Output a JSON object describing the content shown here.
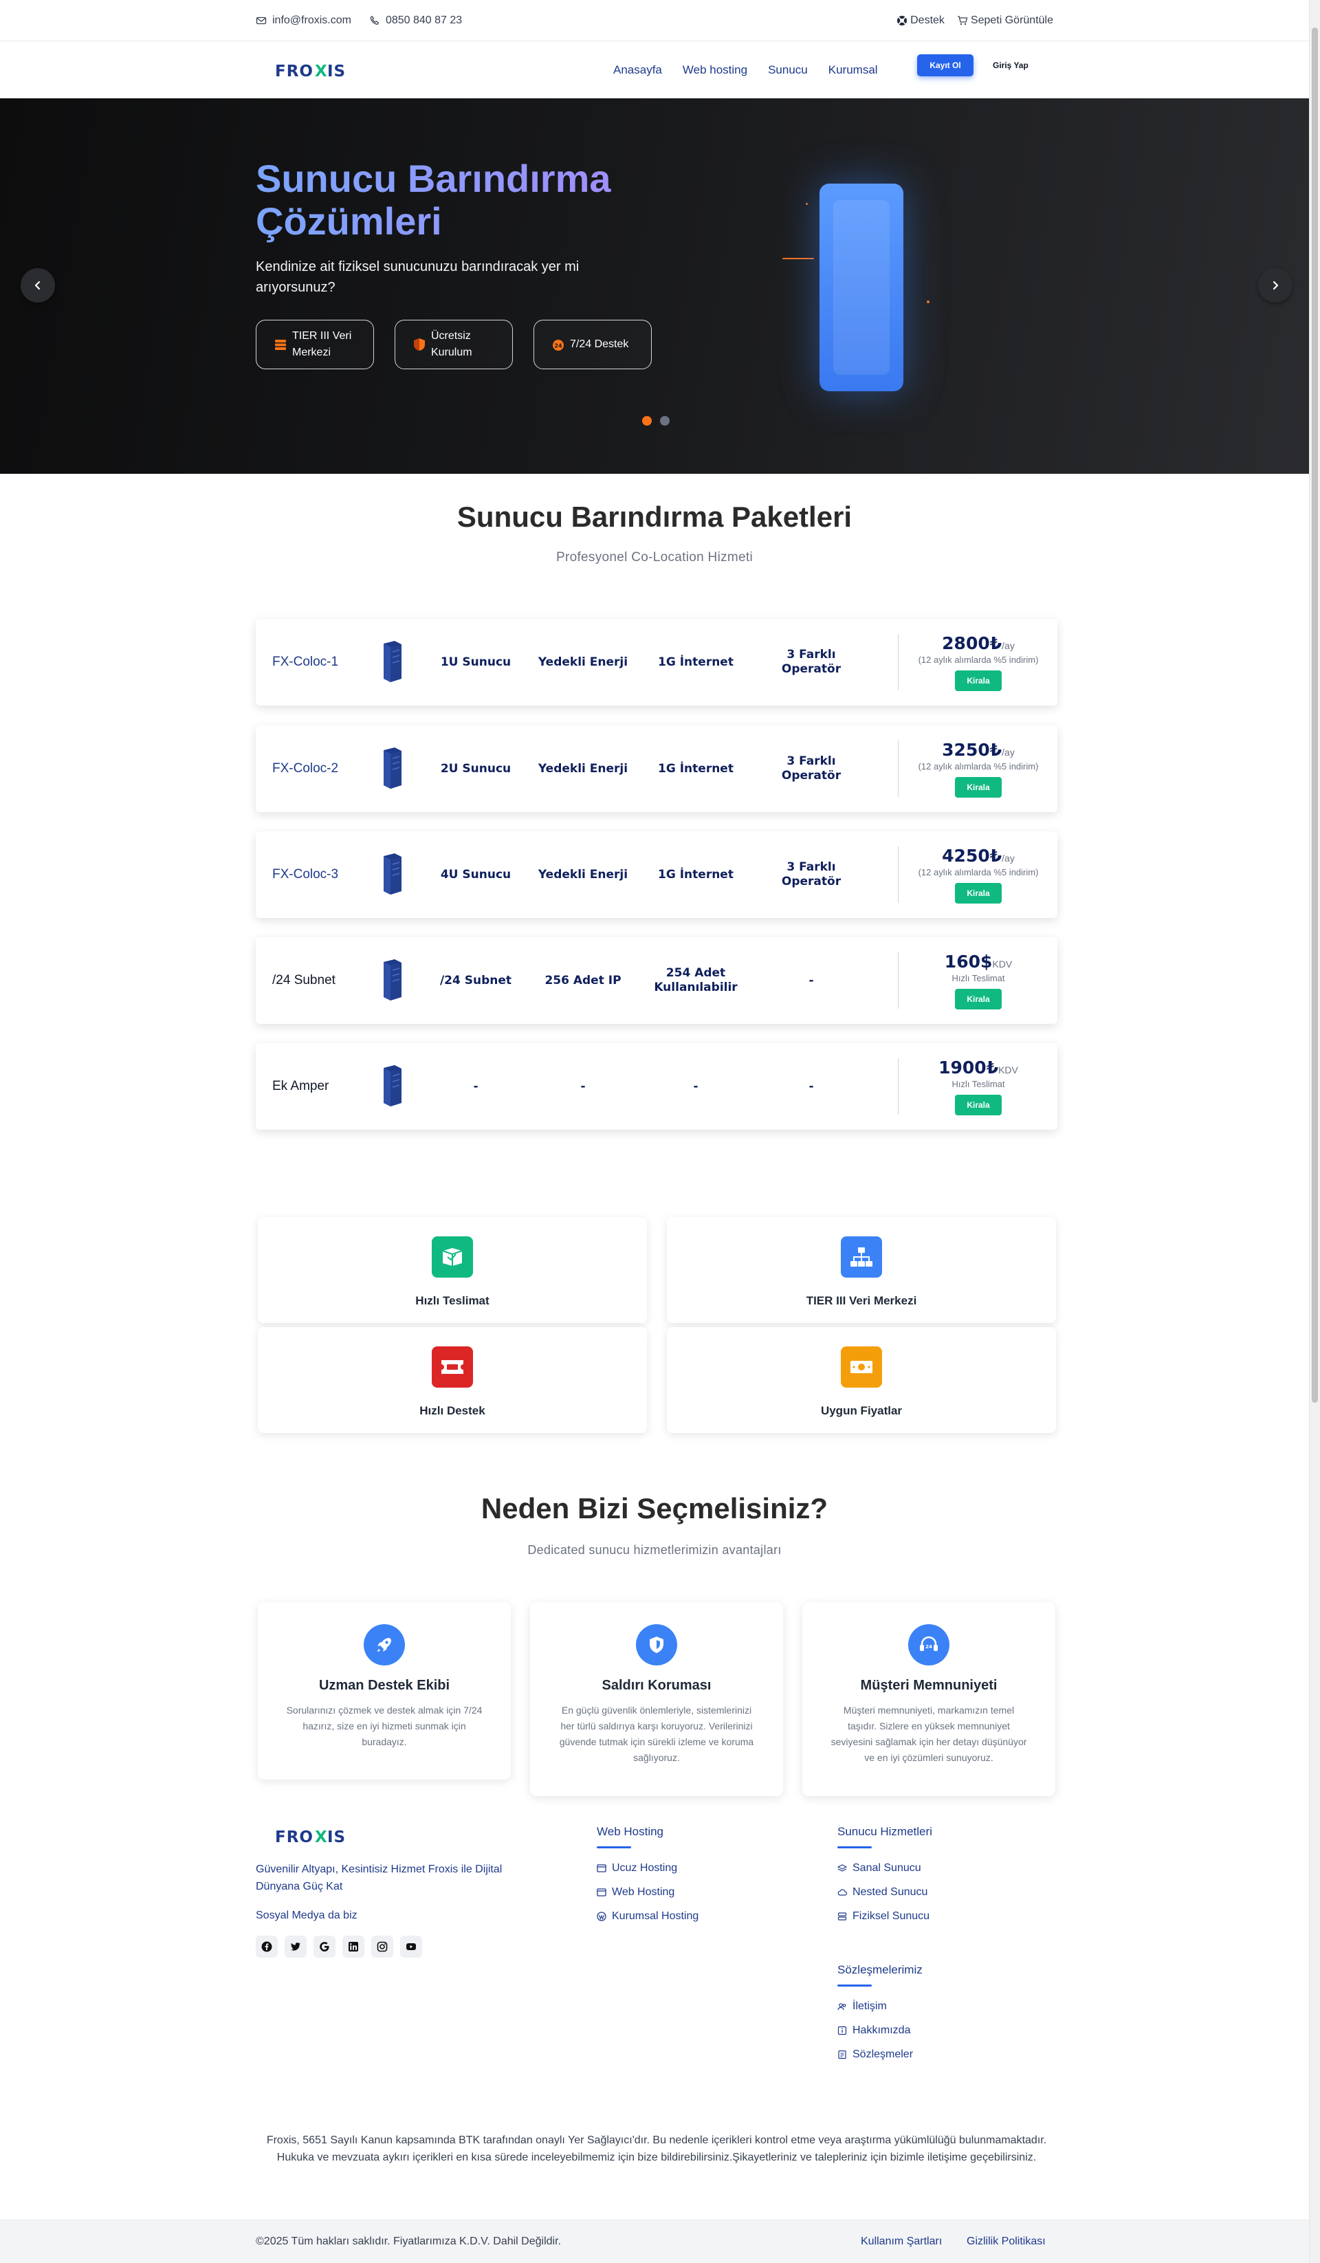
{
  "topbar": {
    "email": "info@froxis.com",
    "phone": "0850 840 87 23",
    "support": "Destek",
    "cart": "Sepeti Görüntüle"
  },
  "brand": {
    "logo_text": "FROXIS",
    "colors": {
      "navy": "#1e3a8a",
      "accent": "#2563eb",
      "orange": "#f97316",
      "green": "#10b981"
    }
  },
  "nav": {
    "links": [
      "Anasayfa",
      "Web hosting",
      "Sunucu",
      "Kurumsal"
    ],
    "register": "Kayıt Ol",
    "login": "Giriş Yap"
  },
  "hero": {
    "title": "Sunucu Barındırma Çözümleri",
    "subtitle": "Kendinize ait fiziksel sunucunuzu barındıracak yer mi arıyorsunuz?",
    "features": [
      {
        "icon": "server-stack-icon",
        "label": "TIER III Veri Merkezi"
      },
      {
        "icon": "shield-icon",
        "label": "Ücretsiz Kurulum"
      },
      {
        "icon": "headset-icon",
        "label": "7/24 Destek"
      }
    ],
    "slides": 2,
    "active_slide": 1
  },
  "packages": {
    "title": "Sunucu Barındırma Paketleri",
    "subtitle": "Profesyonel Co-Location Hizmeti",
    "rent_label": "Kirala",
    "rows": [
      {
        "name": "FX-Coloc-1",
        "specs": [
          "1U Sunucu",
          "Yedekli Enerji",
          "1G İnternet",
          "3 Farklı Operatör"
        ],
        "price": "2800₺",
        "unit": "/ay",
        "note": "(12 aylık alımlarda %5 indirim)"
      },
      {
        "name": "FX-Coloc-2",
        "specs": [
          "2U Sunucu",
          "Yedekli Enerji",
          "1G İnternet",
          "3 Farklı Operatör"
        ],
        "price": "3250₺",
        "unit": "/ay",
        "note": "(12 aylık alımlarda %5 indirim)"
      },
      {
        "name": "FX-Coloc-3",
        "specs": [
          "4U Sunucu",
          "Yedekli Enerji",
          "1G İnternet",
          "3 Farklı Operatör"
        ],
        "price": "4250₺",
        "unit": "/ay",
        "note": "(12 aylık alımlarda %5 indirim)"
      },
      {
        "name": "/24 Subnet",
        "specs": [
          "/24 Subnet",
          "256 Adet IP",
          "254 Adet Kullanılabilir",
          "-"
        ],
        "price": "160$",
        "unit": "KDV",
        "note": "Hızlı Teslimat"
      },
      {
        "name": "Ek Amper",
        "specs": [
          "-",
          "-",
          "-",
          "-"
        ],
        "price": "1900₺",
        "unit": "KDV",
        "note": "Hızlı Teslimat"
      }
    ]
  },
  "features": [
    {
      "icon": "box-icon",
      "label": "Hızlı Teslimat",
      "color": "#10b981"
    },
    {
      "icon": "network-icon",
      "label": "TIER III Veri Merkezi",
      "color": "#3b82f6"
    },
    {
      "icon": "ticket-icon",
      "label": "Hızlı Destek",
      "color": "#dc2626"
    },
    {
      "icon": "money-icon",
      "label": "Uygun Fiyatlar",
      "color": "#f59e0b"
    }
  ],
  "why": {
    "title": "Neden Bizi Seçmelisiniz?",
    "subtitle": "Dedicated sunucu hizmetlerimizin avantajları",
    "cards": [
      {
        "icon": "rocket-icon",
        "title": "Uzman Destek Ekibi",
        "text": "Sorularınızı çözmek ve destek almak için 7/24 hazırız, size en iyi hizmeti sunmak için buradayız."
      },
      {
        "icon": "shield-icon",
        "title": "Saldırı Koruması",
        "text": "En güçlü güvenlik önlemleriyle, sistemlerinizi her türlü saldırıya karşı koruyoruz. Verilerinizi güvende tutmak için sürekli izleme ve koruma sağlıyoruz."
      },
      {
        "icon": "headset-icon",
        "title": "Müşteri Memnuniyeti",
        "text": "Müşteri memnuniyeti, markamızın temel taşıdır. Sizlere en yüksek memnuniyet seviyesini sağlamak için her detayı düşünüyor ve en iyi çözümleri sunuyoruz."
      }
    ]
  },
  "footer": {
    "tagline": "Güvenilir Altyapı, Kesintisiz Hizmet Froxis ile Dijital Dünyana Güç Kat",
    "social_label": "Sosyal Medya da biz",
    "socials": [
      "facebook-icon",
      "twitter-icon",
      "google-icon",
      "linkedin-icon",
      "instagram-icon",
      "youtube-icon"
    ],
    "web_hosting": {
      "title": "Web Hosting",
      "links": [
        "Ucuz Hosting",
        "Web Hosting",
        "Kurumsal Hosting"
      ]
    },
    "server": {
      "title": "Sunucu Hizmetleri",
      "links": [
        "Sanal Sunucu",
        "Nested Sunucu",
        "Fiziksel Sunucu"
      ]
    },
    "contracts": {
      "title": "Sözleşmelerimiz",
      "links": [
        "İletişim",
        "Hakkımızda",
        "Sözleşmeler"
      ]
    },
    "legal_1": "Froxis, 5651 Sayılı Kanun kapsamında BTK tarafından onaylı Yer Sağlayıcı'dır. Bu nedenle içerikleri kontrol etme veya araştırma yükümlülüğü bulunmamaktadır.",
    "legal_2": "Hukuka ve mevzuata aykırı içerikleri en kısa sürede inceleyebilmemiz için bize bildirebilirsiniz.Şikayetleriniz ve talepleriniz için bizimle iletişime geçebilirsiniz.",
    "copyright": "©2025 Tüm hakları saklıdır. Fiyatlarımıza K.D.V. Dahil Değildir.",
    "terms": "Kullanım Şartları",
    "privacy": "Gizlilik Politikası"
  }
}
